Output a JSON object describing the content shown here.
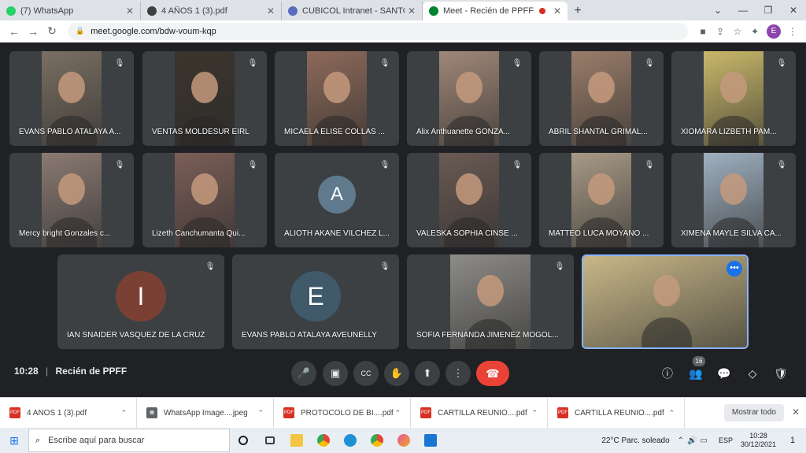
{
  "browser": {
    "tabs": [
      {
        "label": "(7) WhatsApp",
        "color": "#25d366",
        "active": false
      },
      {
        "label": "4 AÑOS 1 (3).pdf",
        "color": "#3c4043",
        "active": false
      },
      {
        "label": "CUBICOL Intranet - SANTO DOM",
        "color": "#5c6bc0",
        "active": false
      },
      {
        "label": "Meet - Recién de PPFF",
        "color": "#00832d",
        "active": true
      }
    ],
    "new_tab": "+",
    "url": "meet.google.com/bdw-voum-kqp",
    "profile_initial": "E"
  },
  "meeting": {
    "time": "10:28",
    "separator": "|",
    "title": "Recién de PPFF",
    "participant_count": "16",
    "participants": [
      {
        "name": "EVANS PABLO ATALAYA A...",
        "video": true,
        "tone": "#7a6f62"
      },
      {
        "name": "VENTAS MOLDESUR EIRL",
        "video": true,
        "tone": "#3b342c"
      },
      {
        "name": "MICAELA ELISE COLLAS ...",
        "video": true,
        "tone": "#8d6a5a"
      },
      {
        "name": "Alix Anthuanette GONZA...",
        "video": true,
        "tone": "#a08878"
      },
      {
        "name": "ABRIL SHANTAL GRIMAL...",
        "video": true,
        "tone": "#9a7d6a"
      },
      {
        "name": "XIOMARA LIZBETH PAM...",
        "video": true,
        "tone": "#c9b86a"
      },
      {
        "name": "Mercy bright Gonzales c...",
        "video": true,
        "tone": "#8a7a72"
      },
      {
        "name": "Lizeth Canchumanta Qui...",
        "video": true,
        "tone": "#7b5e57"
      },
      {
        "name": "ALIOTH AKANE VILCHEZ L...",
        "video": false,
        "initial": "A",
        "avatar_color": "#5f7a8c"
      },
      {
        "name": "VALESKA SOPHIA CINSE ...",
        "video": true,
        "tone": "#6a5a54"
      },
      {
        "name": "MATTEO LUCA MOYANO ...",
        "video": true,
        "tone": "#a89a86"
      },
      {
        "name": "XIMENA MAYLE SILVA CA...",
        "video": true,
        "tone": "#9fb0c0"
      },
      {
        "name": "IAN SNAIDER VASQUEZ DE LA CRUZ",
        "video": false,
        "initial": "I",
        "avatar_color": "#7a4034"
      },
      {
        "name": "EVANS PABLO ATALAYA AVEUNELLY",
        "video": false,
        "initial": "E",
        "avatar_color": "#40596b"
      },
      {
        "name": "SOFIA FERNANDA JIMENEZ MOGOL...",
        "video": true,
        "tone": "#8e8c88"
      },
      {
        "name": "",
        "video": true,
        "tone": "#c8b888",
        "self": true
      }
    ]
  },
  "controls": {
    "mic": "🎤",
    "camera": "▣",
    "captions": "CC",
    "raise_hand": "✋",
    "present": "⬆",
    "more": "⋮",
    "hangup": "☎",
    "info": "ⓘ",
    "people": "👥",
    "chat": "💬",
    "activities": "◇",
    "safety": "🛡"
  },
  "downloads": {
    "items": [
      {
        "name": "4 AÑOS 1 (3).pdf",
        "type": "pdf"
      },
      {
        "name": "WhatsApp Image....jpeg",
        "type": "img"
      },
      {
        "name": "PROTOCOLO DE BI....pdf",
        "type": "pdf"
      },
      {
        "name": "CARTILLA REUNIÓ....pdf",
        "type": "pdf"
      },
      {
        "name": "CARTILLA REUNIÓ....pdf",
        "type": "pdf"
      }
    ],
    "show_all": "Mostrar todo"
  },
  "taskbar": {
    "search_placeholder": "Escribe aquí para buscar",
    "weather": "22°C  Parc. soleado",
    "language": "ESP",
    "time": "10:28",
    "date": "30/12/2021",
    "notifications": "1"
  },
  "colors": {
    "meet_bg": "#202124",
    "tile_bg": "#3c4043",
    "hangup": "#ea4335",
    "accent": "#1a73e8"
  }
}
